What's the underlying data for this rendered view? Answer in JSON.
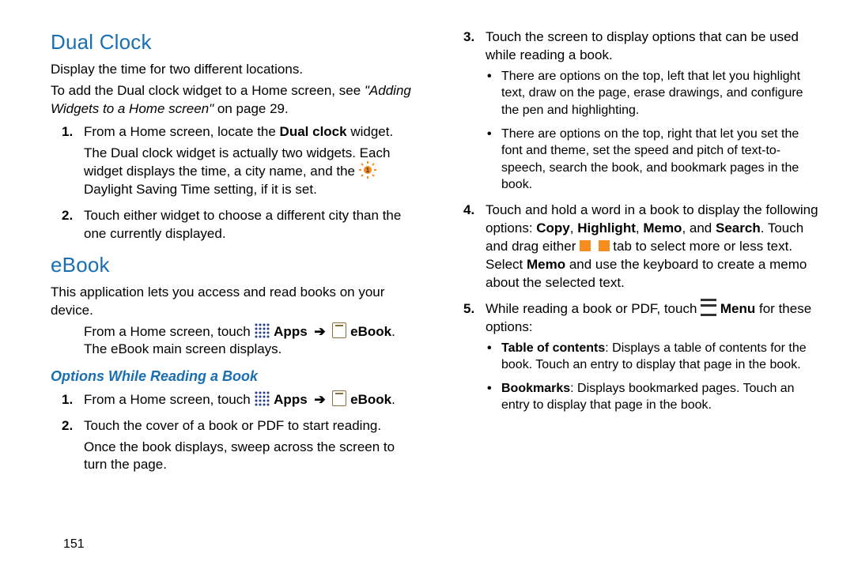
{
  "left": {
    "h_dualclock": "Dual Clock",
    "dualclock_intro": "Display the time for two different locations.",
    "dualclock_add_pre": "To add the Dual clock widget to a Home screen, see ",
    "dualclock_add_ref": "\"Adding Widgets to a Home screen\"",
    "dualclock_add_post": " on page 29.",
    "step1_pre": "From a Home screen, locate the ",
    "step1_bold": "Dual clock",
    "step1_post": " widget.",
    "step1_body_a": "The Dual clock widget is actually two widgets. Each widget displays the time, a city name, and the ",
    "step1_body_b": " Daylight Saving Time setting, if it is set.",
    "step2": "Touch either widget to choose a different city than the one currently displayed.",
    "h_ebook": "eBook",
    "ebook_intro": "This application lets you access and read books on your device.",
    "ebook_open_pre": "From a Home screen, touch ",
    "apps_label": "Apps",
    "ebook_label": "eBook",
    "ebook_open_post": ". The eBook main screen displays.",
    "h_options": "Options While Reading a Book",
    "opt1_pre": "From a Home screen, touch ",
    "opt2": "Touch the cover of a book or PDF to start reading.",
    "opt2_body": "Once the book displays, sweep across the screen to turn the page."
  },
  "right": {
    "step3": "Touch the screen to display options that can be used while reading a book.",
    "step3_b1": "There are options on the top, left that let you highlight text, draw on the page, erase drawings, and configure the pen and highlighting.",
    "step3_b2": "There are options on the top, right that let you set the font and theme, set the speed and pitch of text-to-speech, search the book, and bookmark pages in the book.",
    "step4_a": "Touch and hold a word in a book to display the following options: ",
    "step4_copy": "Copy",
    "step4_hl": "Highlight",
    "step4_memo": "Memo",
    "step4_search": "Search",
    "step4_b": ". Touch and drag either ",
    "step4_c": " tab to select more or less text. Select ",
    "step4_d": " and use the keyboard to create a memo about the selected text.",
    "step5_a": "While reading a book or PDF, touch ",
    "step5_menu": "Menu",
    "step5_b": " for these options:",
    "step5_b1_bold": "Table of contents",
    "step5_b1": ": Displays a table of contents for the book. Touch an entry to display that page in the book.",
    "step5_b2_bold": "Bookmarks",
    "step5_b2": ": Displays bookmarked pages. Touch an entry to display that page in the book."
  },
  "page_number": "151"
}
